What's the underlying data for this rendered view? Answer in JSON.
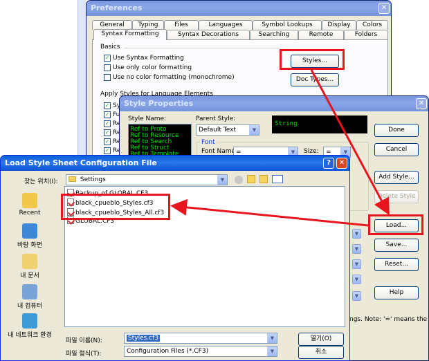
{
  "preferences": {
    "title": "Preferences",
    "tabs_row1": [
      "General",
      "Typing",
      "Files",
      "Languages",
      "Symbol Lookups",
      "Display",
      "Colors"
    ],
    "tabs_row2": [
      "Syntax Formatting",
      "Syntax Decorations",
      "Searching",
      "Remote",
      "Folders"
    ],
    "basics_label": "Basics",
    "options": [
      "Use Syntax Formatting",
      "Use only color formatting",
      "Use no color formatting (monochrome)"
    ],
    "styles_button": "Styles...",
    "doc_types_button": "Doc Types...",
    "apply_label": "Apply Styles for Language Elements",
    "apply_items": [
      "Sym",
      "Fun",
      "Re",
      "Re",
      "Re",
      "Re"
    ]
  },
  "style_props": {
    "title": "Style Properties",
    "style_name_label": "Style Name:",
    "style_list": [
      "Ref to Proto",
      "Ref to Resource",
      "Ref to Search",
      "Ref to Struct",
      "Ref to Template"
    ],
    "parent_label": "Parent Style:",
    "parent_value": "Default Text",
    "preview_text": "String",
    "font_group": "Font",
    "font_name_label": "Font Name:",
    "font_name_value": "=",
    "size_label": "Size:",
    "size_value": "=",
    "buttons": {
      "done": "Done",
      "cancel": "Cancel",
      "add": "Add Style...",
      "delete": "Delete Style",
      "load": "Load...",
      "save": "Save...",
      "reset": "Reset...",
      "help": "Help"
    },
    "note": "ngs. Note: '=' means the"
  },
  "load_dialog": {
    "title": "Load Style Sheet Configuration File",
    "lookin_label": "찾는 위치(I):",
    "lookin_value": "Settings",
    "places": [
      "Recent",
      "바탕 화면",
      "내 문서",
      "내 컴퓨터",
      "내 네트워크 환경"
    ],
    "files": [
      "Backup_of GLOBAL.CF3",
      "black_cpueblo_Styles.cf3",
      "black_cpueblo_Styles_All.cf3",
      "GLOBAL.CF3"
    ],
    "filename_label": "파일 이름(N):",
    "filename_value": "Styles.cf3",
    "filetype_label": "파일 형식(T):",
    "filetype_value": "Configuration Files (*.CF3)",
    "open_button": "열기(O)",
    "cancel_button": "취소"
  },
  "colors": {
    "highlight": "#e8141e",
    "preview_bg": "#000000",
    "preview_fg": "#00e000"
  }
}
